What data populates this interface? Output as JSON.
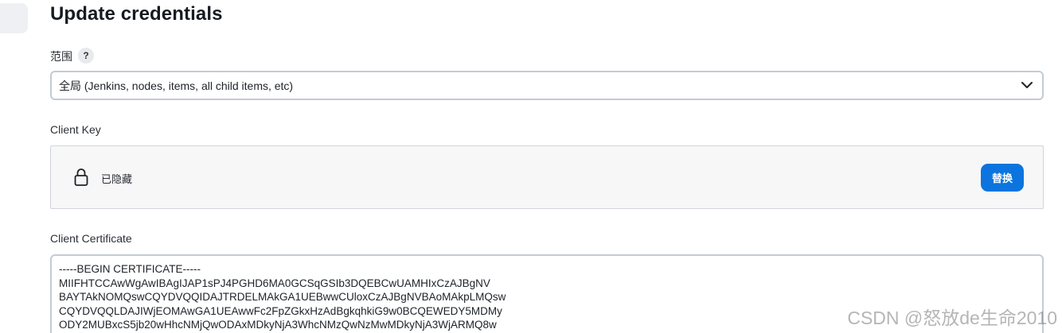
{
  "page_title": "Update credentials",
  "scope": {
    "label": "范围",
    "help_symbol": "?",
    "selected": "全局 (Jenkins, nodes, items, all child items, etc)"
  },
  "client_key": {
    "label": "Client Key",
    "status": "已隐藏",
    "replace_label": "替换",
    "icon": "lock-icon"
  },
  "client_certificate": {
    "label": "Client Certificate",
    "lines": [
      "-----BEGIN CERTIFICATE-----",
      "MIIFHTCCAwWgAwIBAgIJAP1sPJ4PGHD6MA0GCSqGSIb3DQEBCwUAMHIxCzAJBgNV",
      "BAYTAkNOMQswCQYDVQQIDAJTRDELMAkGA1UEBwwCUloxCzAJBgNVBAoMAkpLMQsw",
      "CQYDVQQLDAJIWjEOMAwGA1UEAwwFc2FpZGkxHzAdBgkqhkiG9w0BCQEWEDY5MDMy",
      "ODY2MUBxcS5jb20wHhcNMjQwODAxMDkyNjA3WhcNMzQwNzMwMDkyNjA3WjARMQ8w"
    ]
  },
  "watermark": "CSDN @怒放de生命2010",
  "colors": {
    "accent": "#0b74de",
    "border": "#c3cbd4",
    "panel": "#f7f7f8"
  }
}
